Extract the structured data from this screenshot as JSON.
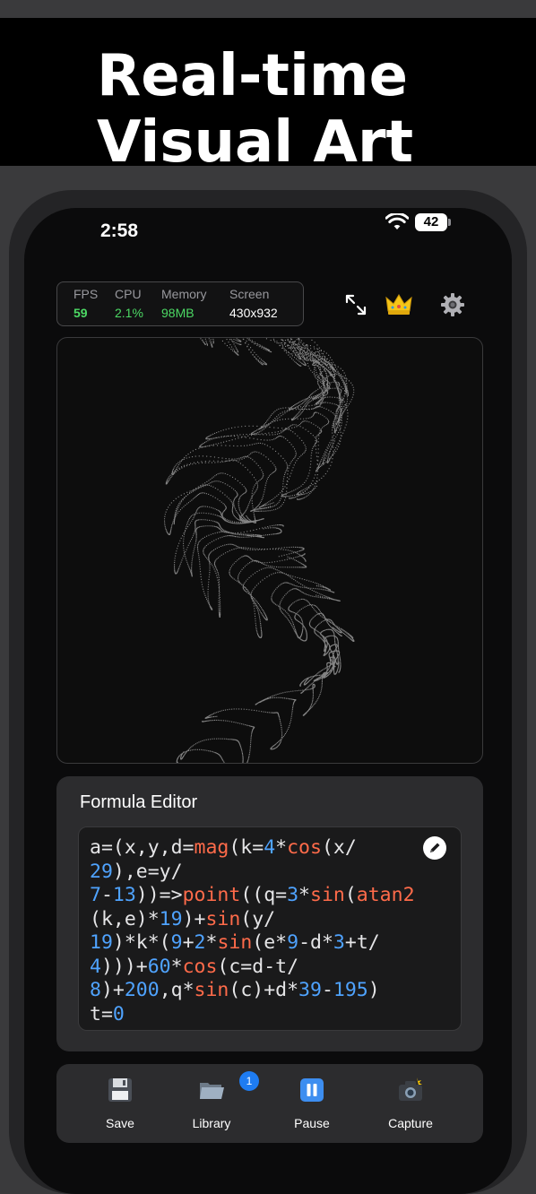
{
  "banner": {
    "title_line1": "Real-time",
    "title_line2": "Visual Art"
  },
  "status_bar": {
    "time": "2:58",
    "battery": "42",
    "icons": [
      "wifi-icon",
      "battery-icon"
    ]
  },
  "stats": [
    {
      "label": "FPS",
      "value": "59"
    },
    {
      "label": "CPU",
      "value": "2.1%"
    },
    {
      "label": "Memory",
      "value": "98MB"
    },
    {
      "label": "Screen",
      "value": "430x932"
    }
  ],
  "header_actions": {
    "icons": [
      "fullscreen-icon",
      "crown-icon",
      "gear-icon"
    ]
  },
  "editor": {
    "title": "Formula Editor",
    "edit_icon": "pencil-icon"
  },
  "toolbar": {
    "items": [
      {
        "label": "Save",
        "icon": "floppy-disk-icon"
      },
      {
        "label": "Library",
        "icon": "folder-icon",
        "badge": "1"
      },
      {
        "label": "Pause",
        "icon": "pause-icon"
      },
      {
        "label": "Capture",
        "icon": "camera-icon"
      }
    ]
  },
  "colors": {
    "accent_green": "#4cd964",
    "code_function": "#ff6b4a",
    "code_number": "#4fa3ff",
    "badge_blue": "#1e7cf2"
  }
}
